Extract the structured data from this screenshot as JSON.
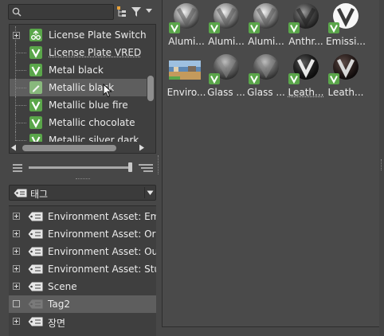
{
  "search": {
    "placeholder": "",
    "value": ""
  },
  "materials_tree": {
    "items": [
      {
        "label": "License Plate Switch",
        "icon": "switch-material-icon"
      },
      {
        "label": "License Plate VRED",
        "icon": "vred-material-icon"
      },
      {
        "label": "Metal black",
        "icon": "vred-material-icon"
      },
      {
        "label": "Metallic black",
        "icon": "vred-material-icon"
      },
      {
        "label": "Metallic blue fire",
        "icon": "vred-material-icon"
      },
      {
        "label": "Metallic chocolate",
        "icon": "vred-material-icon"
      },
      {
        "label": "Metallic silver dark",
        "icon": "vred-material-icon"
      }
    ]
  },
  "tag_filter": {
    "selected": "태그"
  },
  "tag_tree": {
    "items": [
      {
        "label": "Environment Asset: Empt"
      },
      {
        "label": "Environment Asset: Orang"
      },
      {
        "label": "Environment Asset: Outd"
      },
      {
        "label": "Environment Asset: Studi"
      },
      {
        "label": "Scene"
      },
      {
        "label": "Tag2"
      },
      {
        "label": "장면"
      }
    ]
  },
  "thumbnails": [
    {
      "name": "Alumi...",
      "kind": "sphere-chrome"
    },
    {
      "name": "Alumi...",
      "kind": "sphere-chrome"
    },
    {
      "name": "Alumi...",
      "kind": "sphere-chrome"
    },
    {
      "name": "Anthr...",
      "kind": "sphere-dark"
    },
    {
      "name": "Emissi...",
      "kind": "sphere-white-v"
    },
    {
      "name": "Enviro...",
      "kind": "environment"
    },
    {
      "name": "Glass ...",
      "kind": "sphere-glass"
    },
    {
      "name": "Glass ...",
      "kind": "sphere-glass"
    },
    {
      "name": "Leath...",
      "kind": "sphere-black-v"
    },
    {
      "name": "Leath...",
      "kind": "sphere-black-v"
    }
  ],
  "colors": {
    "panel_bg": "#474747",
    "tree_bg": "#3f3f3f",
    "selection": "#5e5e5e",
    "badge_green": "#5aa64a"
  }
}
